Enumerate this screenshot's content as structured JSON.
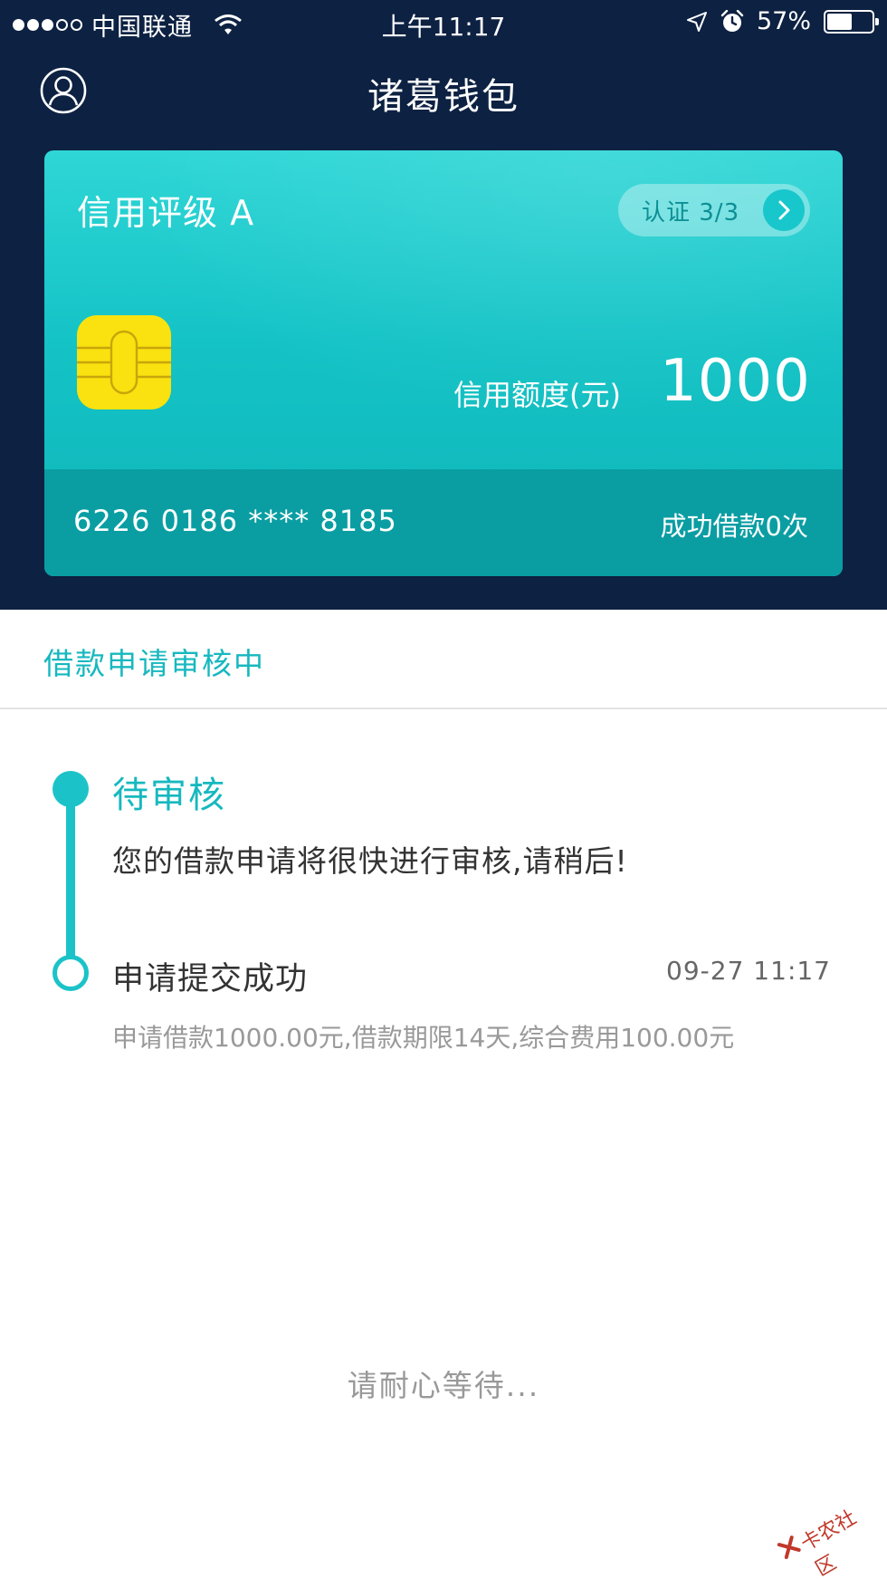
{
  "status_bar": {
    "carrier": "中国联通",
    "time": "上午11:17",
    "battery": "57%",
    "battery_level": 0.57
  },
  "nav": {
    "title": "诸葛钱包",
    "profile_icon": "user-circle-icon"
  },
  "card": {
    "rating": "信用评级 A",
    "verify_label": "认证 3/3",
    "credit_label": "信用额度(元)",
    "credit_value": "1000",
    "card_number": "6226 0186 **** 8185",
    "loan_count": "成功借款0次"
  },
  "status": {
    "title": "借款申请审核中"
  },
  "timeline": [
    {
      "title": "待审核",
      "description": "您的借款申请将很快进行审核,请稍后!",
      "active": true
    },
    {
      "title": "申请提交成功",
      "time": "09-27 11:17",
      "description": "申请借款1000.00元,借款期限14天,综合费用100.00元",
      "active": false
    }
  ],
  "footer": {
    "wait_text": "请耐心等待..."
  },
  "watermark": {
    "text": "卡农社区"
  },
  "colors": {
    "header_bg": "#0d2142",
    "accent": "#1bc3c8",
    "card_top": "#2fd6d6",
    "card_bottom": "#0a9ea3",
    "chip": "#f9e20f"
  }
}
